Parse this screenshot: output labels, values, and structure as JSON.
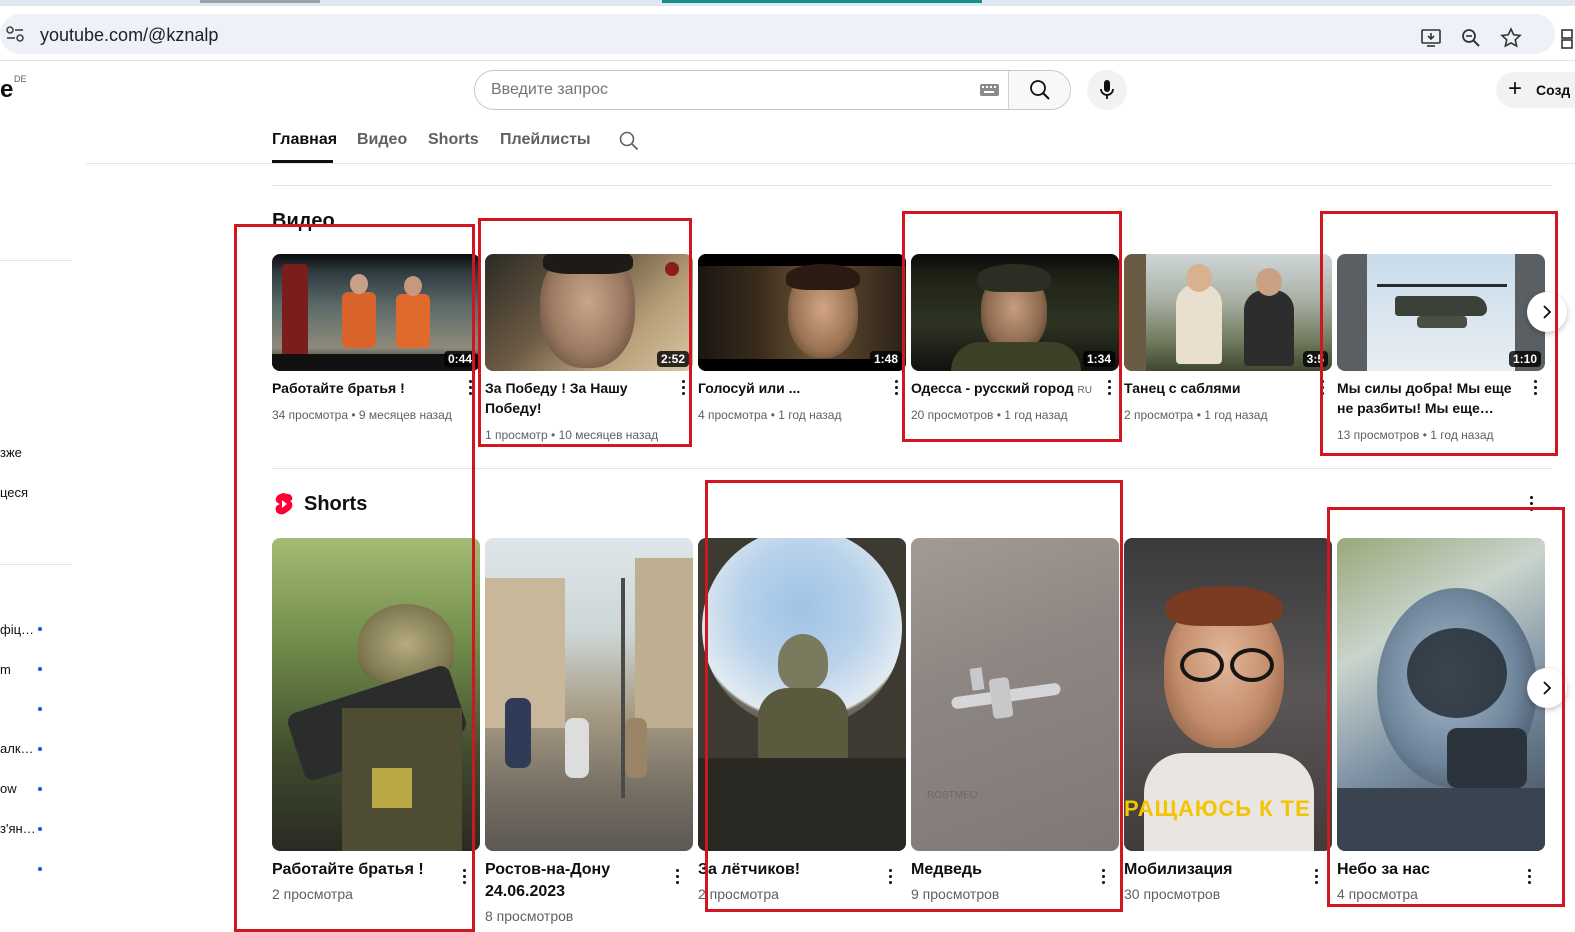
{
  "browser": {
    "url": "youtube.com/@kznalp",
    "icons": [
      "tune-icon",
      "install-app-icon",
      "zoom-icon",
      "bookmark-star-icon",
      "extensions-icon"
    ]
  },
  "header": {
    "logo_fragment": "e",
    "logo_region": "DE",
    "search_placeholder": "Введите запрос",
    "create_label": "Созд"
  },
  "channel_tabs": [
    "Главная",
    "Видео",
    "Shorts",
    "Плейлисты"
  ],
  "sidebar": {
    "fragments": [
      "зже",
      "цеся",
      "фіц…",
      "m",
      "",
      "алк…",
      "ow",
      "з'ян…",
      ""
    ]
  },
  "videos_section": {
    "title": "Видео",
    "items": [
      {
        "title": "Работайте братья !",
        "duration": "0:44",
        "views": "34 просмотра",
        "age": "9 месяцев назад",
        "badge": ""
      },
      {
        "title": "За Победу ! За Нашу Победу!",
        "duration": "2:52",
        "views": "1 просмотр",
        "age": "10 месяцев назад",
        "badge": ""
      },
      {
        "title": "Голосуй или ...",
        "duration": "1:48",
        "views": "4 просмотра",
        "age": "1 год назад",
        "badge": ""
      },
      {
        "title": "Одесса - русский город",
        "duration": "1:34",
        "views": "20 просмотров",
        "age": "1 год назад",
        "badge": "RU"
      },
      {
        "title": "Танец с саблями",
        "duration": "3:5",
        "views": "2 просмотра",
        "age": "1 год назад",
        "badge": ""
      },
      {
        "title": "Мы силы добра! Мы еще не разбиты! Мы еще…",
        "duration": "1:10",
        "views": "13 просмотров",
        "age": "1 год назад",
        "badge": ""
      }
    ]
  },
  "shorts_section": {
    "title": "Shorts",
    "items": [
      {
        "title": "Работайте братья !",
        "views": "2 просмотра"
      },
      {
        "title": "Ростов-на-Дону 24.06.2023",
        "views": "8 просмотров"
      },
      {
        "title": "За лётчиков!",
        "views": "2 просмотра"
      },
      {
        "title": "Медведь",
        "views": "9 просмотров"
      },
      {
        "title": "Мобилизация",
        "views": "30 просмотров"
      },
      {
        "title": "Небо за нас",
        "views": "4 просмотра"
      }
    ],
    "thumb_texts": {
      "watermark": "ROSTMEO",
      "banner": "РАЩАЮСЬ К ТЕ"
    }
  },
  "meta_separator": "•",
  "annotation_color": "#d0161f"
}
